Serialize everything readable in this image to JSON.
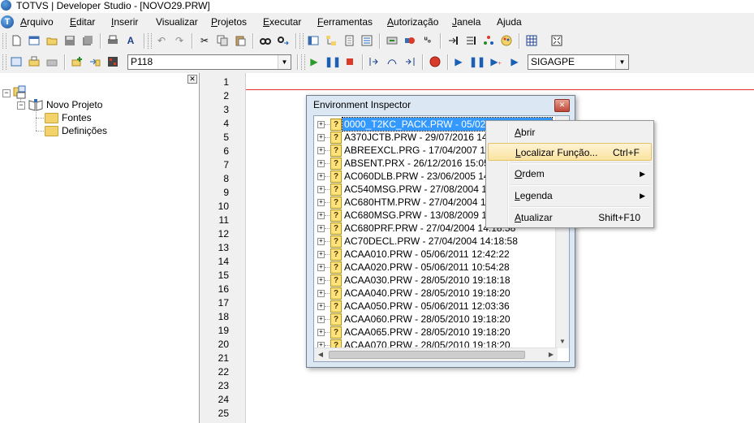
{
  "window": {
    "title": "TOTVS | Developer Studio - [NOVO29.PRW]"
  },
  "menubar": {
    "items": [
      {
        "ul": "A",
        "rest": "rquivo"
      },
      {
        "ul": "E",
        "rest": "ditar"
      },
      {
        "ul": "I",
        "rest": "nserir"
      },
      {
        "ul": "",
        "rest": "Visualizar"
      },
      {
        "ul": "P",
        "rest": "rojetos"
      },
      {
        "ul": "E",
        "rest": "xecutar"
      },
      {
        "ul": "F",
        "rest": "erramentas"
      },
      {
        "ul": "A",
        "rest": "utorização"
      },
      {
        "ul": "J",
        "rest": "anela"
      },
      {
        "ul": "",
        "rest": "Ajuda"
      }
    ]
  },
  "toolbar": {
    "project_combo": "P118",
    "environment_combo": "SIGAGPE",
    "font_button": "A"
  },
  "project_tree": {
    "root": "Novo Projeto",
    "children": [
      "Fontes",
      "Definições"
    ]
  },
  "editor": {
    "line_numbers": [
      "1",
      "2",
      "3",
      "4",
      "5",
      "6",
      "7",
      "8",
      "9",
      "10",
      "11",
      "12",
      "13",
      "14",
      "15",
      "16",
      "17",
      "18",
      "19",
      "20",
      "21",
      "22",
      "23",
      "24",
      "25"
    ]
  },
  "env_inspector": {
    "title": "Environment Inspector",
    "files": [
      "0000_T2KC_PACK.PRW - 05/02/2016 15:56:55",
      "A370JCTB.PRW - 29/07/2016 14:5",
      "ABREEXCL.PRG - 17/04/2007 17:4",
      "ABSENT.PRX - 26/12/2016 15:05:2",
      "AC060DLB.PRW - 23/06/2005 14:0",
      "AC540MSG.PRW - 27/08/2004 10:2",
      "AC680HTM.PRW - 27/04/2004 14:1",
      "AC680MSG.PRW - 13/08/2009 10:4",
      "AC680PRF.PRW - 27/04/2004 14:18:58",
      "AC70DECL.PRW - 27/04/2004 14:18:58",
      "ACAA010.PRW - 05/06/2011 12:42:22",
      "ACAA020.PRW - 05/06/2011 10:54:28",
      "ACAA030.PRW - 28/05/2010 19:18:18",
      "ACAA040.PRW - 28/05/2010 19:18:20",
      "ACAA050.PRW - 05/06/2011 12:03:36",
      "ACAA060.PRW - 28/05/2010 19:18:20",
      "ACAA065.PRW - 28/05/2010 19:18:20",
      "ACAA070.PRW - 28/05/2010 19:18:20"
    ]
  },
  "context_menu": {
    "abrir": {
      "ul": "A",
      "rest": "brir"
    },
    "localizar": {
      "ul": "L",
      "rest": "ocalizar Função...",
      "shortcut": "Ctrl+F"
    },
    "ordem": {
      "ul": "O",
      "rest": "rdem"
    },
    "legenda": {
      "ul": "L",
      "rest": "egenda"
    },
    "atualizar": {
      "ul": "A",
      "rest": "tualizar",
      "shortcut": "Shift+F10"
    }
  }
}
